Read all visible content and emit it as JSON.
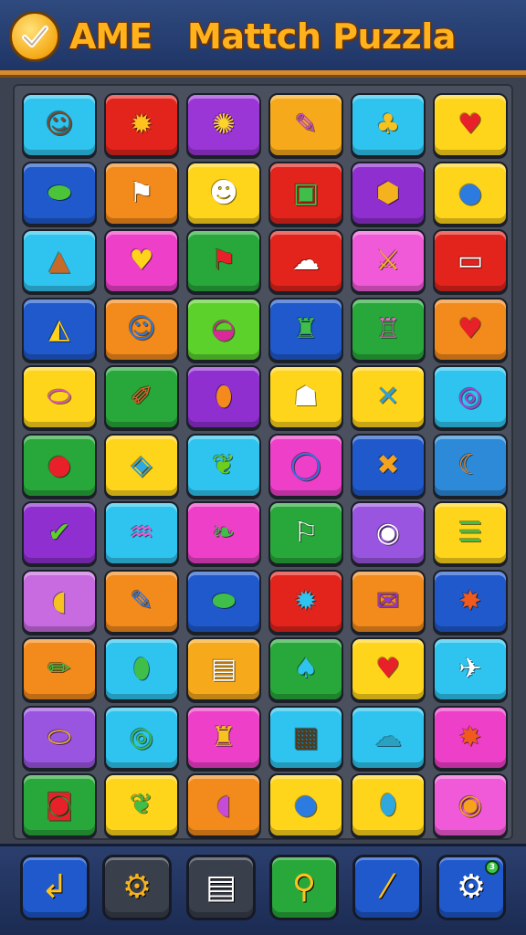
{
  "header": {
    "brand": "AME",
    "title": "Mattch Puzzla"
  },
  "board": {
    "rows": [
      [
        {
          "bg": "#2fc4ef",
          "icon": "face-icon",
          "glyph": "☺",
          "color": "#7a4a2a"
        },
        {
          "bg": "#e2241c",
          "icon": "sun-star-icon",
          "glyph": "✹",
          "color": "#ffc21f"
        },
        {
          "bg": "#9a35d6",
          "icon": "leaf-sun-icon",
          "glyph": "✺",
          "color": "#ffd42a"
        },
        {
          "bg": "#f6a91b",
          "icon": "pen-tool-icon",
          "glyph": "✎",
          "color": "#c64bd8"
        },
        {
          "bg": "#2fc4ef",
          "icon": "blob-icon",
          "glyph": "♣",
          "color": "#f5c21f"
        },
        {
          "bg": "#ffd51c",
          "icon": "heart-icon",
          "glyph": "♥",
          "color": "#e8202a"
        }
      ],
      [
        {
          "bg": "#1f59cc",
          "icon": "cannon-icon",
          "glyph": "⬬",
          "color": "#4cc43a"
        },
        {
          "bg": "#f28a1c",
          "icon": "flag-icon",
          "glyph": "⚑",
          "color": "#ffffff"
        },
        {
          "bg": "#ffd51c",
          "icon": "cat-face-icon",
          "glyph": "☻",
          "color": "#ffffff"
        },
        {
          "bg": "#e2241c",
          "icon": "jar-icon",
          "glyph": "▣",
          "color": "#3fbf4a"
        },
        {
          "bg": "#8f2fd0",
          "icon": "gem-icon",
          "glyph": "⬢",
          "color": "#f5b21f"
        },
        {
          "bg": "#ffd51c",
          "icon": "planet-icon",
          "glyph": "●",
          "color": "#2c7be0"
        }
      ],
      [
        {
          "bg": "#2fc4ef",
          "icon": "cone-creature-icon",
          "glyph": "▲",
          "color": "#c66a2a"
        },
        {
          "bg": "#ee3fc8",
          "icon": "heart-badge-icon",
          "glyph": "♥",
          "color": "#ffd21c"
        },
        {
          "bg": "#28a83a",
          "icon": "flag-icon",
          "glyph": "⚑",
          "color": "#e8202a"
        },
        {
          "bg": "#e2241c",
          "icon": "fish-ghost-icon",
          "glyph": "☁",
          "color": "#ffffff"
        },
        {
          "bg": "#f05ad8",
          "icon": "sword-icon",
          "glyph": "⚔",
          "color": "#f5b21f"
        },
        {
          "bg": "#e2241c",
          "icon": "ticket-icon",
          "glyph": "▭",
          "color": "#ffffff"
        }
      ],
      [
        {
          "bg": "#1f59cc",
          "icon": "triangle-ruler-icon",
          "glyph": "◭",
          "color": "#ffd21c"
        },
        {
          "bg": "#f28a1c",
          "icon": "smiley-ball-icon",
          "glyph": "☺",
          "color": "#2c7be0"
        },
        {
          "bg": "#5cd12c",
          "icon": "pot-icon",
          "glyph": "◒",
          "color": "#d8289a"
        },
        {
          "bg": "#1f59cc",
          "icon": "bag-icon",
          "glyph": "♜",
          "color": "#3fbf4a"
        },
        {
          "bg": "#28a83a",
          "icon": "jar-icon",
          "glyph": "♖",
          "color": "#f06ad0"
        },
        {
          "bg": "#f28a1c",
          "icon": "heart-icon",
          "glyph": "♥",
          "color": "#e8202a"
        }
      ],
      [
        {
          "bg": "#ffd51c",
          "icon": "bandage-icon",
          "glyph": "⬭",
          "color": "#e84ad8"
        },
        {
          "bg": "#28a83a",
          "icon": "crayon-icon",
          "glyph": "✐",
          "color": "#f05a28"
        },
        {
          "bg": "#8f2fd0",
          "icon": "planet-ring-icon",
          "glyph": "⬮",
          "color": "#f58a1c"
        },
        {
          "bg": "#ffd51c",
          "icon": "ghost-icon",
          "glyph": "☗",
          "color": "#ffffff"
        },
        {
          "bg": "#ffd51c",
          "icon": "knot-icon",
          "glyph": "✕",
          "color": "#2ca0e0"
        },
        {
          "bg": "#2fc4ef",
          "icon": "swirl-icon",
          "glyph": "◎",
          "color": "#b83ad8"
        }
      ],
      [
        {
          "bg": "#28a83a",
          "icon": "red-ball-icon",
          "glyph": "●",
          "color": "#e8202a"
        },
        {
          "bg": "#ffd51c",
          "icon": "box-icon",
          "glyph": "◈",
          "color": "#2fa8e0"
        },
        {
          "bg": "#2fc4ef",
          "icon": "leaf-icon",
          "glyph": "❦",
          "color": "#6ccf1c"
        },
        {
          "bg": "#ee3fc8",
          "icon": "ring-icon",
          "glyph": "◯",
          "color": "#2c7be0"
        },
        {
          "bg": "#1f59cc",
          "icon": "crossed-swords-icon",
          "glyph": "✖",
          "color": "#f5a21c"
        },
        {
          "bg": "#2c8ad8",
          "icon": "crescent-icon",
          "glyph": "☾",
          "color": "#f58a1c"
        }
      ],
      [
        {
          "bg": "#8f2fd0",
          "icon": "check-icon",
          "glyph": "✔",
          "color": "#5cd12c"
        },
        {
          "bg": "#2fc4ef",
          "icon": "fish-icon",
          "glyph": "♒",
          "color": "#f05ad8"
        },
        {
          "bg": "#ee3fc8",
          "icon": "cherries-icon",
          "glyph": "❧",
          "color": "#3fbf4a"
        },
        {
          "bg": "#28a83a",
          "icon": "flag-icon",
          "glyph": "⚐",
          "color": "#ffffff"
        },
        {
          "bg": "#9a55e0",
          "icon": "eye-icon",
          "glyph": "◉",
          "color": "#ffffff"
        },
        {
          "bg": "#ffd51c",
          "icon": "fence-icon",
          "glyph": "☰",
          "color": "#3fbf4a"
        }
      ],
      [
        {
          "bg": "#c86ae0",
          "icon": "fish-icon",
          "glyph": "◖",
          "color": "#f5c21f"
        },
        {
          "bg": "#f28a1c",
          "icon": "pencil-icon",
          "glyph": "✎",
          "color": "#3a7be0"
        },
        {
          "bg": "#1f59cc",
          "icon": "car-icon",
          "glyph": "⬬",
          "color": "#3fbf4a"
        },
        {
          "bg": "#e2241c",
          "icon": "star-eye-icon",
          "glyph": "✹",
          "color": "#2fc4ef"
        },
        {
          "bg": "#f28a1c",
          "icon": "envelope-icon",
          "glyph": "✉",
          "color": "#9a35d6"
        },
        {
          "bg": "#1f59cc",
          "icon": "burst-icon",
          "glyph": "✸",
          "color": "#f05a1c"
        }
      ],
      [
        {
          "bg": "#f28a1c",
          "icon": "pencil-icon",
          "glyph": "✏",
          "color": "#3fbf4a"
        },
        {
          "bg": "#2fc4ef",
          "icon": "caterpillar-icon",
          "glyph": "⬮",
          "color": "#3fbf4a"
        },
        {
          "bg": "#f6a91b",
          "icon": "robot-face-icon",
          "glyph": "▤",
          "color": "#ffffff"
        },
        {
          "bg": "#28a83a",
          "icon": "spoon-icon",
          "glyph": "♠",
          "color": "#2fc4ef"
        },
        {
          "bg": "#ffd51c",
          "icon": "heart-icon",
          "glyph": "♥",
          "color": "#e8202a"
        },
        {
          "bg": "#2fc4ef",
          "icon": "bird-icon",
          "glyph": "✈",
          "color": "#ffffff"
        }
      ],
      [
        {
          "bg": "#9a55e0",
          "icon": "scroll-icon",
          "glyph": "⬭",
          "color": "#f5b21f"
        },
        {
          "bg": "#2fc4ef",
          "icon": "spiral-icon",
          "glyph": "◎",
          "color": "#3fbf4a"
        },
        {
          "bg": "#ee3fc8",
          "icon": "chair-icon",
          "glyph": "♜",
          "color": "#f5c21f"
        },
        {
          "bg": "#2fc4ef",
          "icon": "counter-icon",
          "glyph": "▦",
          "color": "#5a3a1a"
        },
        {
          "bg": "#2fc4ef",
          "icon": "cloud-face-icon",
          "glyph": "☁",
          "color": "#2ca0c0"
        },
        {
          "bg": "#ee3fc8",
          "icon": "burst-icon",
          "glyph": "✸",
          "color": "#f05a1c"
        }
      ],
      [
        {
          "bg": "#28a83a",
          "icon": "eye-badge-icon",
          "glyph": "◙",
          "color": "#e8202a"
        },
        {
          "bg": "#ffd51c",
          "icon": "dragon-icon",
          "glyph": "❦",
          "color": "#3fbf4a"
        },
        {
          "bg": "#f28a1c",
          "icon": "fish-ball-icon",
          "glyph": "◖",
          "color": "#c64bd8"
        },
        {
          "bg": "#ffd51c",
          "icon": "planet-icon",
          "glyph": "●",
          "color": "#2c7be0"
        },
        {
          "bg": "#ffd51c",
          "icon": "balloon-icon",
          "glyph": "⬮",
          "color": "#2fa8e0"
        },
        {
          "bg": "#f05ad8",
          "icon": "shell-eye-icon",
          "glyph": "◉",
          "color": "#f5a21c"
        }
      ]
    ]
  },
  "toolbar": {
    "buttons": [
      {
        "name": "back-button",
        "icon": "back-arrow-icon",
        "glyph": "↲",
        "bg": "#1f59cc",
        "color": "#ffc21f"
      },
      {
        "name": "settings-button",
        "icon": "gear-icon",
        "glyph": "⚙",
        "bg": "#3a3f4c",
        "color": "#f5b21f"
      },
      {
        "name": "level-button",
        "icon": "clipboard-icon",
        "glyph": "▤",
        "bg": "#3a3f4c",
        "color": "#ffffff"
      },
      {
        "name": "search-button",
        "icon": "magnifier-icon",
        "glyph": "⚲",
        "bg": "#28a83a",
        "color": "#ffc21f"
      },
      {
        "name": "hint-button",
        "icon": "wand-icon",
        "glyph": "⁄",
        "bg": "#1f59cc",
        "color": "#ffc21f"
      },
      {
        "name": "refresh-button",
        "icon": "gear-refresh-icon",
        "glyph": "⚙",
        "bg": "#1f59cc",
        "color": "#ffffff",
        "badge": "3"
      }
    ]
  }
}
